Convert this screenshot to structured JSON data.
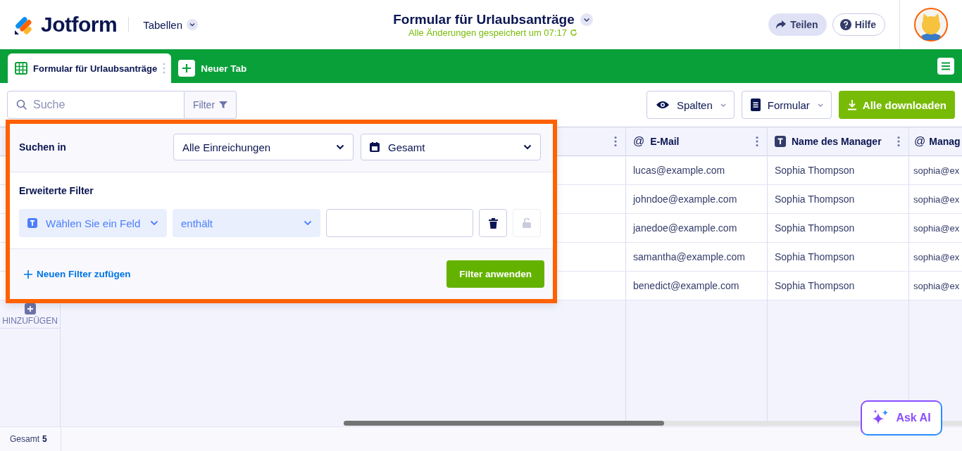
{
  "header": {
    "brand": "Jotform",
    "section": "Tabellen",
    "title": "Formular für Urlaubsanträge",
    "saved": "Alle Änderungen gespeichert um 07:17",
    "buttons": [
      {
        "kind": "share",
        "label": "Teilen"
      },
      {
        "kind": "help",
        "label": "Hilfe"
      }
    ]
  },
  "tabs": [
    {
      "label": "Formular für Urlaubsanträge",
      "selected": true
    }
  ],
  "new_tab": "Neuer Tab",
  "toolbar": {
    "search": {
      "placeholder": "Suche"
    },
    "filter": "Filter",
    "columns": "Spalten",
    "form": "Formular",
    "download": "Alle downloaden"
  },
  "table": {
    "columns": [
      {
        "kind": "email",
        "icon": "@",
        "label": "E-Mail"
      },
      {
        "kind": "text",
        "label": "Name des Manager"
      },
      {
        "kind": "email",
        "icon": "@",
        "label": "Manag"
      }
    ],
    "rows": [
      [
        "lucas@example.com",
        "Sophia Thompson",
        "sophia@ex"
      ],
      [
        "johndoe@example.com",
        "Sophia Thompson",
        "sophia@ex"
      ],
      [
        "janedoe@example.com",
        "Sophia Thompson",
        "sophia@ex"
      ],
      [
        "samantha@example.com",
        "Sophia Thompson",
        "sophia@ex"
      ],
      [
        "benedict@example.com",
        "Sophia Thompson",
        "sophia@ex"
      ]
    ],
    "add_row": "HINZUFÜGEN"
  },
  "filter_panel": {
    "search_in_label": "Suchen in",
    "scope": "Alle Einreichungen",
    "period": "Gesamt",
    "advanced_label": "Erweiterte Filter",
    "field": "Wählen Sie ein Feld",
    "operator": "enthält",
    "add_filter": "Neuen Filter zufügen",
    "apply": "Filter anwenden"
  },
  "footer": {
    "total_label": "Gesamt",
    "total": "5"
  },
  "ask_ai": "Ask AI"
}
